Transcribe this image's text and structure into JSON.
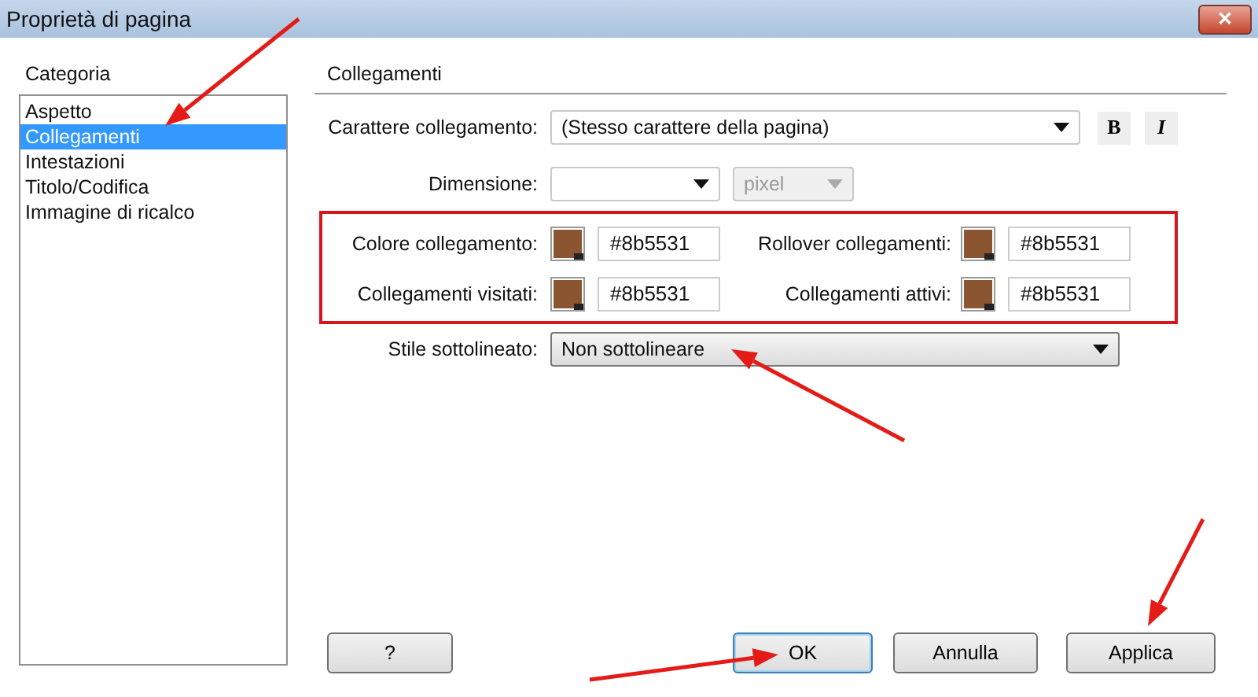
{
  "window": {
    "title": "Proprietà di pagina",
    "close": "✕"
  },
  "category": {
    "label": "Categoria",
    "items": [
      {
        "label": "Aspetto",
        "selected": false
      },
      {
        "label": "Collegamenti",
        "selected": true
      },
      {
        "label": "Intestazioni",
        "selected": false
      },
      {
        "label": "Titolo/Codifica",
        "selected": false
      },
      {
        "label": "Immagine di ricalco",
        "selected": false
      }
    ]
  },
  "section": {
    "title": "Collegamenti"
  },
  "font": {
    "label": "Carattere collegamento:",
    "value": "(Stesso carattere della pagina)",
    "bold": "B",
    "italic": "I"
  },
  "size": {
    "label": "Dimensione:",
    "unit": "pixel",
    "unit_disabled": true
  },
  "colors": [
    {
      "label": "Colore collegamento:",
      "color": "#8b5531",
      "value": "#8b5531"
    },
    {
      "label": "Rollover collegamenti:",
      "color": "#8b5531",
      "value": "#8b5531"
    },
    {
      "label": "Collegamenti visitati:",
      "color": "#8b5531",
      "value": "#8b5531"
    },
    {
      "label": "Collegamenti attivi:",
      "color": "#8b5531",
      "value": "#8b5531"
    }
  ],
  "underline": {
    "label": "Stile sottolineato:",
    "value": "Non sottolineare"
  },
  "buttons": [
    {
      "label": "?",
      "kind": "help",
      "selected": false
    },
    {
      "label": "OK",
      "kind": "ok",
      "selected": true
    },
    {
      "label": "Annulla",
      "kind": "cancel",
      "selected": false
    },
    {
      "label": "Applica",
      "kind": "apply",
      "selected": false
    }
  ],
  "annotations": {
    "arrows": true,
    "highlight": true
  }
}
